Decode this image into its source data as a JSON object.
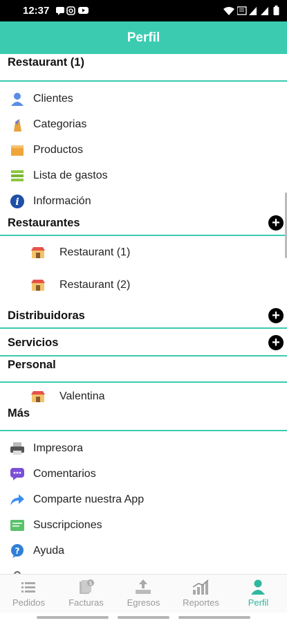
{
  "status_bar": {
    "time": "12:37"
  },
  "header": {
    "title": "Perfil"
  },
  "top_section": {
    "title": "Restaurant (1)"
  },
  "menu": [
    {
      "label": "Clientes",
      "icon": "person-icon"
    },
    {
      "label": "Categorias",
      "icon": "category-icon"
    },
    {
      "label": "Productos",
      "icon": "box-icon"
    },
    {
      "label": "Lista de gastos",
      "icon": "list-icon"
    },
    {
      "label": "Información",
      "icon": "info-icon"
    }
  ],
  "restaurantes": {
    "title": "Restaurantes",
    "items": [
      {
        "label": "Restaurant (1)"
      },
      {
        "label": "Restaurant (2)"
      }
    ]
  },
  "distribuidoras": {
    "title": "Distribuidoras"
  },
  "servicios": {
    "title": "Servicios"
  },
  "personal": {
    "title": "Personal",
    "items": [
      {
        "label": "Valentina"
      }
    ]
  },
  "mas": {
    "title": "Más",
    "items": [
      {
        "label": "Impresora",
        "icon": "printer-icon"
      },
      {
        "label": "Comentarios",
        "icon": "chat-icon"
      },
      {
        "label": "Comparte nuestra App",
        "icon": "share-icon"
      },
      {
        "label": "Suscripciones",
        "icon": "subscription-icon"
      },
      {
        "label": "Ayuda",
        "icon": "help-icon"
      }
    ]
  },
  "bottom_nav": [
    {
      "label": "Pedidos",
      "icon": "list-icon"
    },
    {
      "label": "Facturas",
      "icon": "invoice-icon"
    },
    {
      "label": "Egresos",
      "icon": "expenses-icon"
    },
    {
      "label": "Reportes",
      "icon": "chart-icon"
    },
    {
      "label": "Perfil",
      "icon": "profile-icon",
      "active": true
    }
  ],
  "colors": {
    "accent": "#3bcbb0",
    "active_tab": "#2fb89d",
    "inactive_tab": "#9a9a9a"
  }
}
